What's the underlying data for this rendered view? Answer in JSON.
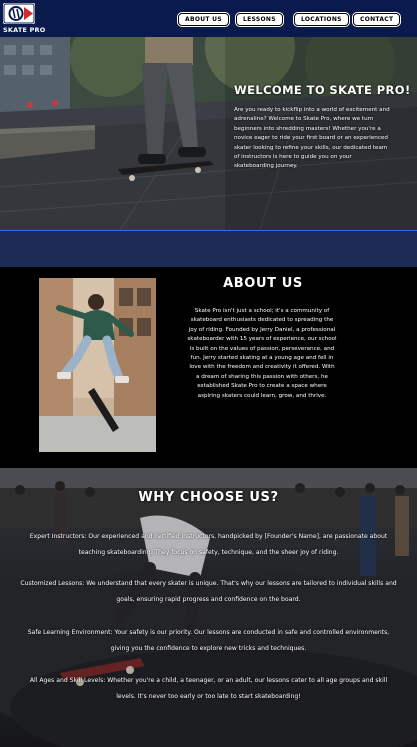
{
  "header": {
    "logo_text": "SKATE PRO",
    "nav": [
      {
        "label": "ABOUT US"
      },
      {
        "label": "LESSONS"
      },
      {
        "label": "LOCATIONS"
      },
      {
        "label": "CONTACT"
      }
    ]
  },
  "hero": {
    "title": "WELCOME TO SKATE PRO!",
    "text": "Are you ready to kickflip into a world of excitement and adrenaline? Welcome to Skate Pro, where we turn beginners into shredding masters! Whether you're a novice eager to ride your first board or an experienced skater looking to refine your skills, our dedicated team of instructors is here to guide you on your skateboarding journey."
  },
  "about": {
    "title": "ABOUT US",
    "text": "Skate Pro isn't just a school; it's a community of skateboard enthusiasts dedicated to spreading the joy of riding. Founded by Jerry Daniel, a professional skateboarder with 15 years of experience, our school is built on the values of passion, perseverance, and fun. Jerry started skating at a young age and fell in love with the freedom and creativity it offered. With a dream of sharing this passion with others, he established Skate Pro to create a space where aspiring skaters could learn, grow, and thrive."
  },
  "why": {
    "title": "WHY CHOOSE US?",
    "items": [
      {
        "text": "Expert Instructors: Our experienced and certified instructors, handpicked by [Founder's Name], are passionate about teaching skateboarding. They focus on safety, technique, and the sheer joy of riding."
      },
      {
        "text": "Customized Lessons: We understand that every skater is unique. That's why our lessons are tailored to individual skills and goals, ensuring rapid progress and confidence on the board."
      },
      {
        "text": "Safe Learning Environment: Your safety is our priority. Our lessons are conducted in safe and controlled environments, giving you the confidence to explore new tricks and techniques."
      },
      {
        "text": "All Ages and Skill Levels: Whether you're a child, a teenager, or an adult, our lessons cater to all age groups and skill levels. It's never too early or too late to start skateboarding!"
      }
    ]
  },
  "colors": {
    "header_bg": "#0b1a4c",
    "strip_bg": "#1d2b56",
    "strip_border": "#2f6dd8",
    "page_bg": "#000000"
  }
}
